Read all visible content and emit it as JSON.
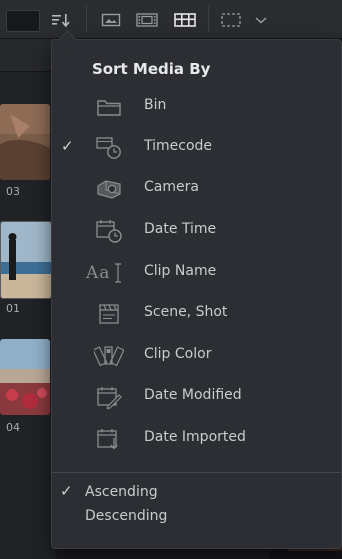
{
  "menu": {
    "title": "Sort Media By",
    "items": [
      {
        "label": "Bin",
        "icon": "folder-icon",
        "checked": false
      },
      {
        "label": "Timecode",
        "icon": "timecode-icon",
        "checked": true
      },
      {
        "label": "Camera",
        "icon": "camera-icon",
        "checked": false
      },
      {
        "label": "Date Time",
        "icon": "calendar-clock-icon",
        "checked": false
      },
      {
        "label": "Clip Name",
        "icon": "text-cursor-icon",
        "checked": false
      },
      {
        "label": "Scene, Shot",
        "icon": "clapperboard-icon",
        "checked": false
      },
      {
        "label": "Clip Color",
        "icon": "color-swatch-icon",
        "checked": false
      },
      {
        "label": "Date Modified",
        "icon": "calendar-edit-icon",
        "checked": false
      },
      {
        "label": "Date Imported",
        "icon": "calendar-import-icon",
        "checked": false
      }
    ],
    "check_glyph": "✓",
    "order": [
      {
        "label": "Ascending",
        "checked": true
      },
      {
        "label": "Descending",
        "checked": false
      }
    ],
    "clip_name_glyph": "Aa"
  },
  "clips": [
    {
      "label": "03"
    },
    {
      "label": "01"
    },
    {
      "label": "04"
    }
  ],
  "colors": {
    "menu_bg": "#2c2e33",
    "text": "#c9cbce",
    "icon": "#8a8c90"
  }
}
